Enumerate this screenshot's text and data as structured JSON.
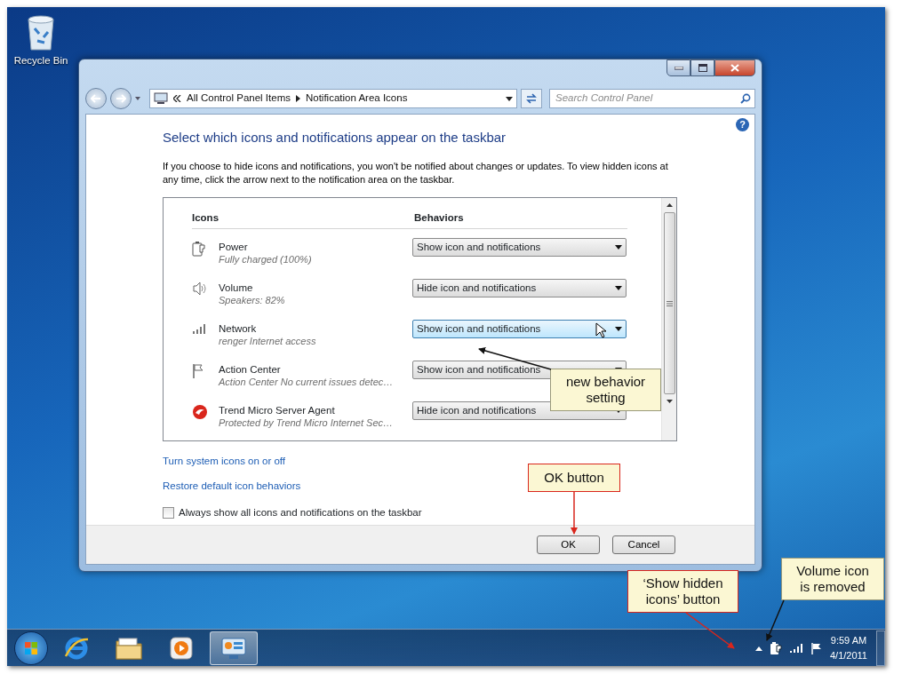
{
  "desktop_icons": [
    {
      "label": "Recycle Bin"
    }
  ],
  "window": {
    "breadcrumb": [
      "All Control Panel Items",
      "Notification Area Icons"
    ],
    "search": {
      "placeholder": "Search Control Panel"
    },
    "help": "?",
    "heading": "Select which icons and notifications appear on the taskbar",
    "description": "If you choose to hide icons and notifications, you won't be notified about changes or updates. To view hidden icons at any time, click the arrow next to the notification area on the taskbar.",
    "table": {
      "columns": [
        "Icons",
        "Behaviors"
      ],
      "rows": [
        {
          "kind": "power",
          "name": "Power",
          "detail": "Fully charged (100%)",
          "behavior": "Show icon and notifications",
          "selected": false
        },
        {
          "kind": "volume",
          "name": "Volume",
          "detail": "Speakers: 82%",
          "behavior": "Hide icon and notifications",
          "selected": false
        },
        {
          "kind": "network",
          "name": "Network",
          "detail": "renger Internet access",
          "behavior": "Show icon and notifications",
          "selected": true
        },
        {
          "kind": "flag",
          "name": "Action Center",
          "detail": "Action Center  No current issues detec…",
          "behavior": "Show icon and notifications",
          "selected": false
        },
        {
          "kind": "shield",
          "name": "Trend Micro Server Agent",
          "detail": "Protected by Trend Micro Internet Sec…",
          "behavior": "Hide icon and notifications",
          "selected": false
        }
      ]
    },
    "links": [
      "Turn system icons on or off",
      "Restore default icon behaviors"
    ],
    "checkbox": {
      "label": "Always show all icons and notifications on the taskbar",
      "checked": false
    },
    "buttons": [
      "OK",
      "Cancel"
    ]
  },
  "taskbar": {
    "apps": [
      {
        "kind": "browser",
        "selected": false
      },
      {
        "kind": "folder",
        "selected": false
      },
      {
        "kind": "media",
        "selected": false
      },
      {
        "kind": "control-panel",
        "selected": true
      }
    ],
    "tray": [
      {
        "kind": "show-hidden"
      },
      {
        "kind": "power"
      },
      {
        "kind": "network"
      },
      {
        "kind": "flag"
      }
    ],
    "time": "9:59 AM",
    "date": "4/1/2011"
  },
  "callouts": [
    {
      "text": "new behavior setting",
      "kind": "plain"
    },
    {
      "text": "OK button",
      "kind": "red"
    },
    {
      "text": "Volume icon is removed",
      "kind": "plain"
    },
    {
      "text": "‘Show hidden icons’ button",
      "kind": "red"
    }
  ]
}
